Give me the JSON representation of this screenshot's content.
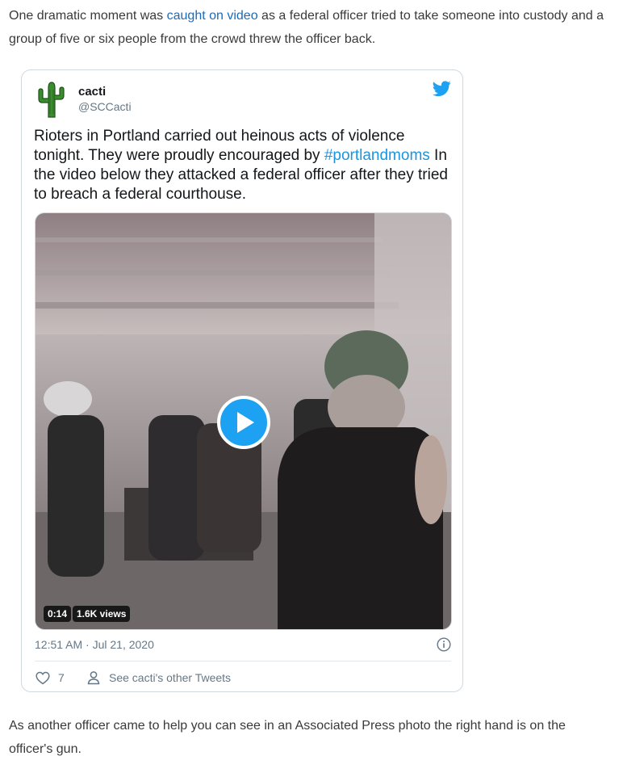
{
  "article": {
    "para1_before": "One dramatic moment was ",
    "para1_link": "caught on video",
    "para1_after": " as a federal officer tried to take someone into custody and a group of five or six people from the crowd threw the officer back.",
    "para2": "As another officer came to help you can see in an Associated Press photo the right hand is on the officer's gun."
  },
  "tweet": {
    "author_name": "cacti",
    "author_handle": "@SCCacti",
    "text_before": "Rioters in Portland carried out heinous acts of violence tonight. They were proudly encouraged by ",
    "hashtag": "#portlandmoms",
    "text_after": " In the video below they attacked a federal officer after they tried to breach a federal courthouse.",
    "video_duration": "0:14",
    "video_views": "1.6K views",
    "timestamp": "12:51 AM · Jul 21, 2020",
    "like_count": "7",
    "other_tweets_label": "See cacti's other Tweets",
    "icons": [
      "cactus-avatar-icon",
      "twitter-bird-icon",
      "play-icon",
      "info-icon",
      "heart-icon",
      "person-icon"
    ],
    "colors": {
      "link": "#1e6ab7",
      "twitter_blue": "#1da1f2",
      "hashtag": "#1b95e0",
      "muted": "#657786"
    }
  }
}
